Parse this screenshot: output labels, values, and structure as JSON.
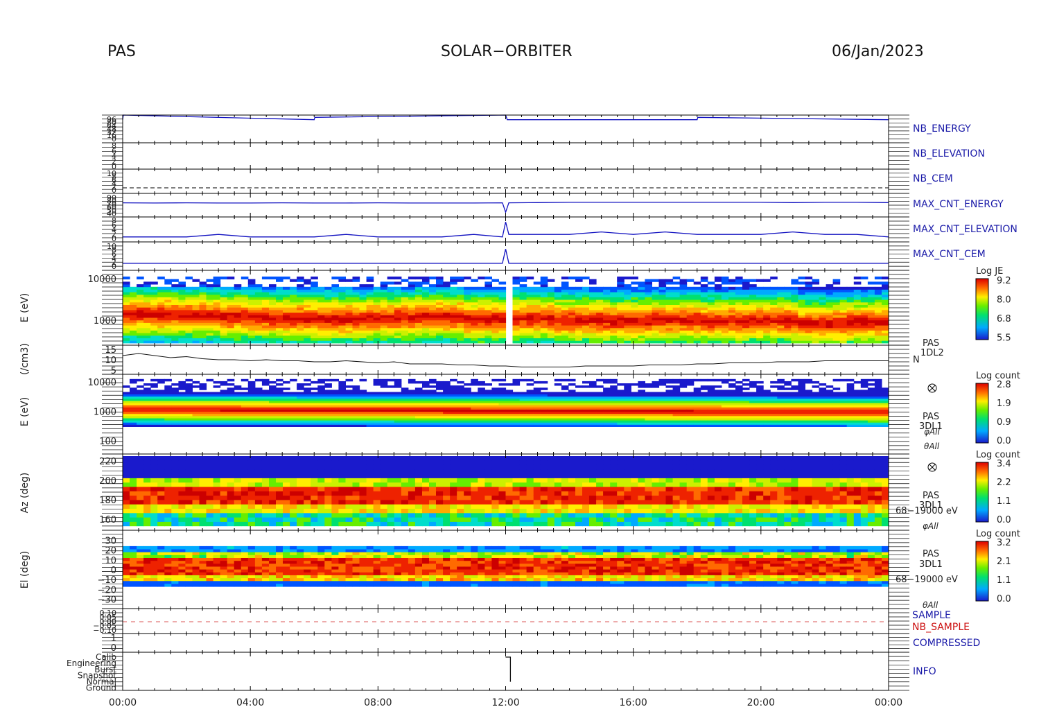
{
  "header": {
    "instrument": "PAS",
    "mission": "SOLAR−ORBITER",
    "date": "06/Jan/2023"
  },
  "time_axis": {
    "tick_labels": [
      "00:00",
      "04:00",
      "08:00",
      "12:00",
      "16:00",
      "20:00",
      "00:00"
    ],
    "hours": [
      0,
      4,
      8,
      12,
      16,
      20,
      24
    ]
  },
  "chart_data": [
    {
      "type": "line",
      "id": "nb-energy",
      "label": "NB_ENERGY",
      "ytick_labels": [
        "96",
        "80",
        "64",
        "48",
        "32",
        "16",
        "0"
      ],
      "x_hours": [
        0,
        0.02,
        6.0,
        6.02,
        12.0,
        12.05,
        18.0,
        18.02,
        24
      ],
      "values": [
        80,
        96,
        80,
        88,
        96,
        80,
        80,
        88,
        80
      ]
    },
    {
      "type": "line",
      "id": "nb-elevation",
      "label": "NB_ELEVATION",
      "ytick_labels": [
        "8",
        "6",
        "4",
        "2",
        "0"
      ],
      "x_hours": [],
      "values": []
    },
    {
      "type": "line",
      "id": "nb-cem",
      "label": "NB_CEM",
      "ytick_labels": [
        "10",
        "8",
        "6",
        "4",
        "2",
        "0"
      ],
      "x_hours": [
        0,
        24
      ],
      "values": [
        0,
        0
      ],
      "dashed": true
    },
    {
      "type": "line",
      "id": "max-cnt-energy",
      "label": "MAX_CNT_ENERGY",
      "ytick_labels": [
        "90",
        "80",
        "70",
        "60",
        "50",
        "40"
      ],
      "x_hours": [
        0,
        1,
        2,
        3,
        4,
        5,
        6,
        7,
        8,
        9,
        10,
        11,
        11.9,
        12.0,
        12.1,
        13,
        14,
        15,
        16,
        17,
        18,
        19,
        20,
        21,
        22,
        23,
        24
      ],
      "values": [
        60,
        59,
        60,
        59,
        59,
        60,
        59,
        59,
        60,
        59,
        59,
        59,
        60,
        20,
        60,
        61,
        62,
        62,
        62,
        62,
        62,
        62,
        62,
        61,
        62,
        62,
        61
      ]
    },
    {
      "type": "line",
      "id": "max-cnt-elevation",
      "label": "MAX_CNT_ELEVATION",
      "ytick_labels": [
        "8",
        "6",
        "4",
        "2",
        "0"
      ],
      "x_hours": [
        0,
        1,
        2,
        3,
        4,
        5,
        6,
        7,
        8,
        9,
        10,
        11,
        11.9,
        12.0,
        12.1,
        13,
        14,
        15,
        16,
        17,
        18,
        19,
        20,
        21,
        22,
        23,
        24
      ],
      "values": [
        2,
        2,
        2,
        3,
        2,
        2,
        2,
        3,
        2,
        2,
        2,
        3,
        2,
        8,
        3,
        3,
        3,
        4,
        3,
        4,
        3,
        3,
        3,
        4,
        3,
        3,
        2
      ]
    },
    {
      "type": "line",
      "id": "max-cnt-cem",
      "label": "MAX_CNT_CEM",
      "ytick_labels": [
        "10",
        "8",
        "6",
        "4",
        "2",
        "0"
      ],
      "x_hours": [
        0,
        1,
        2,
        3,
        4,
        5,
        6,
        7,
        8,
        9,
        10,
        11,
        11.9,
        12.0,
        12.1,
        13,
        14,
        15,
        16,
        17,
        18,
        19,
        20,
        21,
        22,
        23,
        24
      ],
      "values": [
        3,
        3,
        3,
        3,
        3,
        3,
        3,
        3,
        3,
        3,
        3,
        3,
        3,
        9,
        3,
        3,
        3,
        3,
        3,
        3,
        3,
        3,
        3,
        3,
        3,
        3,
        3
      ]
    },
    {
      "type": "heatmap",
      "id": "energy-spectrogram",
      "ylabel": "E (eV)",
      "ytick_labels": [
        "10000",
        "1000"
      ],
      "colorbar": {
        "title": "Log JE",
        "tick_labels": [
          "9.2",
          "8.0",
          "6.8",
          "5.5"
        ]
      },
      "center_log_energy": [
        3.12,
        3.1,
        3.05,
        3.02,
        3.0,
        3.03,
        3.06,
        3.0,
        3.02,
        2.98,
        2.96,
        2.98,
        2.95,
        2.97,
        2.9,
        2.93
      ],
      "band_note": ""
    },
    {
      "type": "line",
      "id": "density",
      "ylabel": "(/cm3)",
      "label_lines": [
        "PAS",
        "1DL2",
        "N"
      ],
      "ytick_labels": [
        "15",
        "10",
        "5"
      ],
      "ylim": [
        3,
        17
      ],
      "x_hours": [
        0,
        0.5,
        1,
        1.5,
        2,
        2.5,
        3,
        3.5,
        4,
        4.5,
        5,
        5.5,
        6,
        6.5,
        7,
        7.5,
        8,
        8.5,
        9,
        9.5,
        10,
        10.5,
        11,
        11.5,
        12,
        12.5,
        13,
        13.5,
        14,
        14.5,
        15,
        15.5,
        16,
        16.5,
        17,
        17.5,
        18,
        18.5,
        19,
        19.5,
        20,
        20.5,
        21,
        21.5,
        22,
        22.5,
        23,
        23.5,
        24
      ],
      "values": [
        12,
        13,
        12,
        11,
        11.5,
        10.5,
        10,
        10,
        9.5,
        10,
        9.5,
        9.5,
        9,
        9,
        9.5,
        9,
        8.5,
        9,
        8,
        8,
        8,
        7.5,
        7.5,
        7,
        7,
        6.5,
        6.5,
        6.5,
        6.5,
        7,
        7,
        7,
        7,
        7.5,
        7.5,
        7.5,
        8,
        8,
        8.5,
        8.5,
        8.5,
        9,
        9,
        9,
        9.5,
        9.5,
        9.5,
        9.5,
        9.5
      ]
    },
    {
      "type": "heatmap",
      "id": "count-spectrogram",
      "ylabel": "E (eV)",
      "ytick_labels": [
        "10000",
        "1000",
        "100"
      ],
      "label_lines": [
        "PAS",
        "3DL1",
        "φAll",
        "θAll"
      ],
      "colorbar": {
        "title": "Log count",
        "tick_labels": [
          "2.8",
          "1.9",
          "0.9",
          "0.0"
        ]
      }
    },
    {
      "type": "heatmap",
      "id": "azimuth",
      "ylabel": "Az (deg)",
      "ytick_labels": [
        "220",
        "200",
        "180",
        "160"
      ],
      "label_lines": [
        "PAS",
        "3DL1",
        "68−19000 eV",
        "φAll"
      ],
      "colorbar": {
        "title": "Log count",
        "tick_labels": [
          "3.4",
          "2.2",
          "1.1",
          "0.0"
        ]
      }
    },
    {
      "type": "heatmap",
      "id": "elevation",
      "ylabel": "El (deg)",
      "ytick_labels": [
        "30",
        "20",
        "10",
        "0",
        "−10",
        "−20",
        "−30"
      ],
      "label_lines": [
        "PAS",
        "3DL1",
        "68−19000 eV",
        "θAll"
      ],
      "colorbar": {
        "title": "Log count",
        "tick_labels": [
          "3.2",
          "2.1",
          "1.1",
          "0.0"
        ]
      }
    },
    {
      "type": "line",
      "id": "sample",
      "label_lines": [
        "SAMPLE",
        "NB_SAMPLE"
      ],
      "ytick_labels": [
        "0.10",
        "0.05",
        "0.00",
        "−0.05",
        "−0.10"
      ],
      "x_hours": [
        0,
        24
      ],
      "values": [
        0,
        0
      ],
      "dashed": true
    },
    {
      "type": "line",
      "id": "compressed",
      "label": "COMPRESSED",
      "ytick_labels": [
        "1",
        "0"
      ],
      "x_hours": [],
      "values": []
    },
    {
      "type": "line",
      "id": "info",
      "label": "INFO",
      "ytick_labels": [
        "Calib",
        "Engineering",
        "Burst",
        "Snapshot",
        "Normal",
        "Ground"
      ],
      "x_hours": [
        12.0,
        12.0,
        12.15,
        12.15
      ],
      "values": [
        5,
        5,
        5,
        1
      ]
    }
  ],
  "colors": {
    "trace_blue": "#1010c0",
    "label_blue": "#1a1aa8",
    "label_red": "#cc1111",
    "axis": "#000000"
  }
}
